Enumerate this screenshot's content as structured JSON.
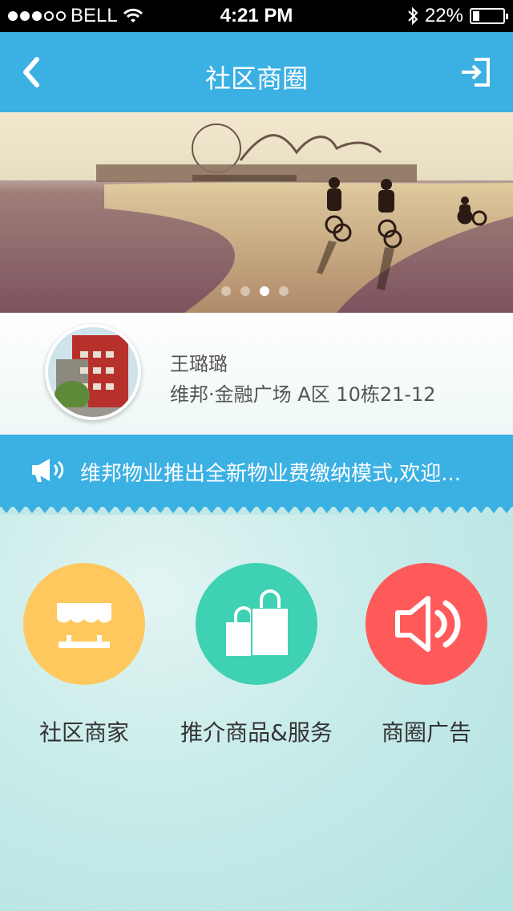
{
  "status_bar": {
    "carrier": "BELL",
    "time": "4:21 PM",
    "battery_percent": "22%"
  },
  "nav": {
    "title": "社区商圈"
  },
  "banner": {
    "page_count": 4,
    "active_index": 2
  },
  "user": {
    "name": "王璐璐",
    "address": "维邦·金融广场 A区 10栋21-12"
  },
  "notice": {
    "text": "维邦物业推出全新物业费缴纳模式,欢迎..."
  },
  "categories": [
    {
      "label": "社区商家",
      "color": "#ffc85e",
      "icon": "storefront-icon"
    },
    {
      "label": "推介商品&服务",
      "color": "#3fd1b3",
      "icon": "shopping-bags-icon"
    },
    {
      "label": "商圈广告",
      "color": "#ff5a5a",
      "icon": "speaker-icon"
    }
  ]
}
